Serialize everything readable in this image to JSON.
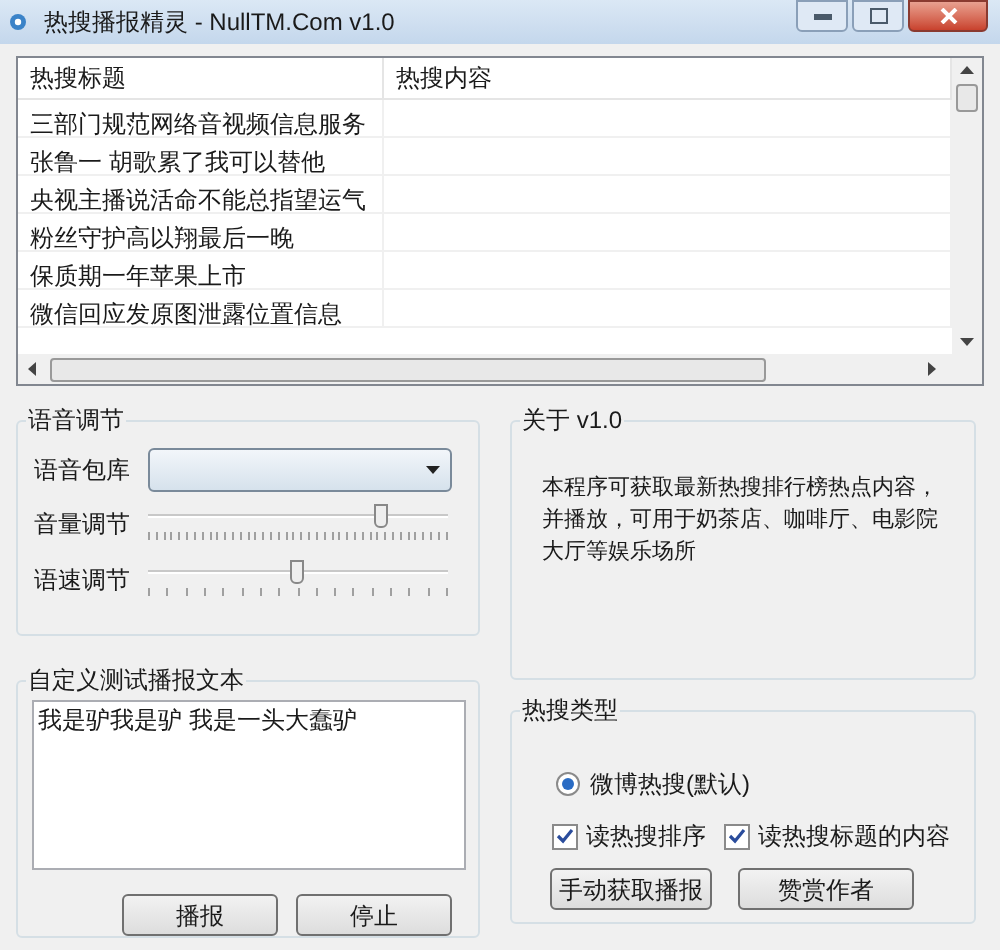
{
  "window": {
    "title": "热搜播报精灵 - NullTM.Com v1.0"
  },
  "table": {
    "columns": [
      "热搜标题",
      "热搜内容"
    ],
    "rows": [
      [
        "三部门规范网络音视频信息服务",
        ""
      ],
      [
        "张鲁一 胡歌累了我可以替他",
        ""
      ],
      [
        "央视主播说活命不能总指望运气",
        ""
      ],
      [
        "粉丝守护高以翔最后一晚",
        ""
      ],
      [
        "保质期一年苹果上市",
        ""
      ],
      [
        "微信回应发原图泄露位置信息",
        ""
      ]
    ]
  },
  "voice_group": {
    "title": "语音调节",
    "library_label": "语音包库",
    "sliders": [
      {
        "label": "音量调节",
        "level": 0.78
      },
      {
        "label": "语速调节",
        "level": 0.5
      }
    ]
  },
  "custom_group": {
    "title": "自定义测试播报文本",
    "value": "我是驴我是驴 我是一头大蠢驴",
    "buttons": [
      "播报",
      "停止"
    ]
  },
  "about_group": {
    "title": "关于 v1.0",
    "text": "本程序可获取最新热搜排行榜热点内容，并播放，可用于奶茶店、咖啡厅、电影院大厅等娱乐场所"
  },
  "type_group": {
    "title": "热搜类型",
    "radios": [
      {
        "label": "微博热搜(默认)",
        "selected": true
      }
    ],
    "checkboxes": [
      {
        "label": "读热搜排序",
        "checked": true
      },
      {
        "label": "读热搜标题的内容",
        "checked": true
      }
    ],
    "buttons": [
      "手动获取播报",
      "赞赏作者"
    ]
  }
}
